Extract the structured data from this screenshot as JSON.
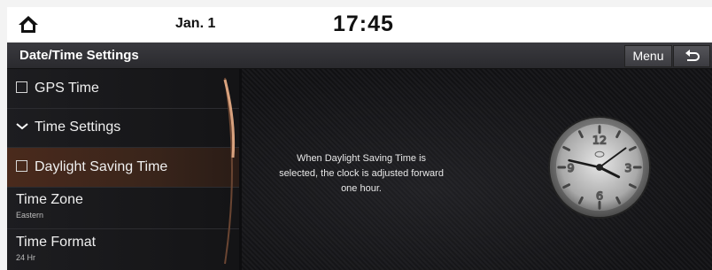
{
  "status_bar": {
    "date": "Jan. 1",
    "time": "17:45"
  },
  "header": {
    "title": "Date/Time Settings",
    "menu_label": "Menu"
  },
  "list": {
    "items": [
      {
        "label": "GPS Time",
        "type": "checkbox",
        "checked": false
      },
      {
        "label": "Time Settings",
        "type": "expand"
      },
      {
        "label": "Daylight Saving Time",
        "type": "checkbox",
        "checked": false,
        "selected": true
      },
      {
        "label": "Time Zone",
        "value": "Eastern"
      },
      {
        "label": "Time Format",
        "value": "24 Hr"
      }
    ]
  },
  "description": "When Daylight Saving Time is selected, the clock is adjusted forward one hour.",
  "clock": {
    "numerals": [
      "12",
      "3",
      "6",
      "9"
    ],
    "hour_hand": 5,
    "minute_hand": 45
  },
  "colors": {
    "accent": "#c7794d",
    "selection": "#4a2a1c"
  }
}
